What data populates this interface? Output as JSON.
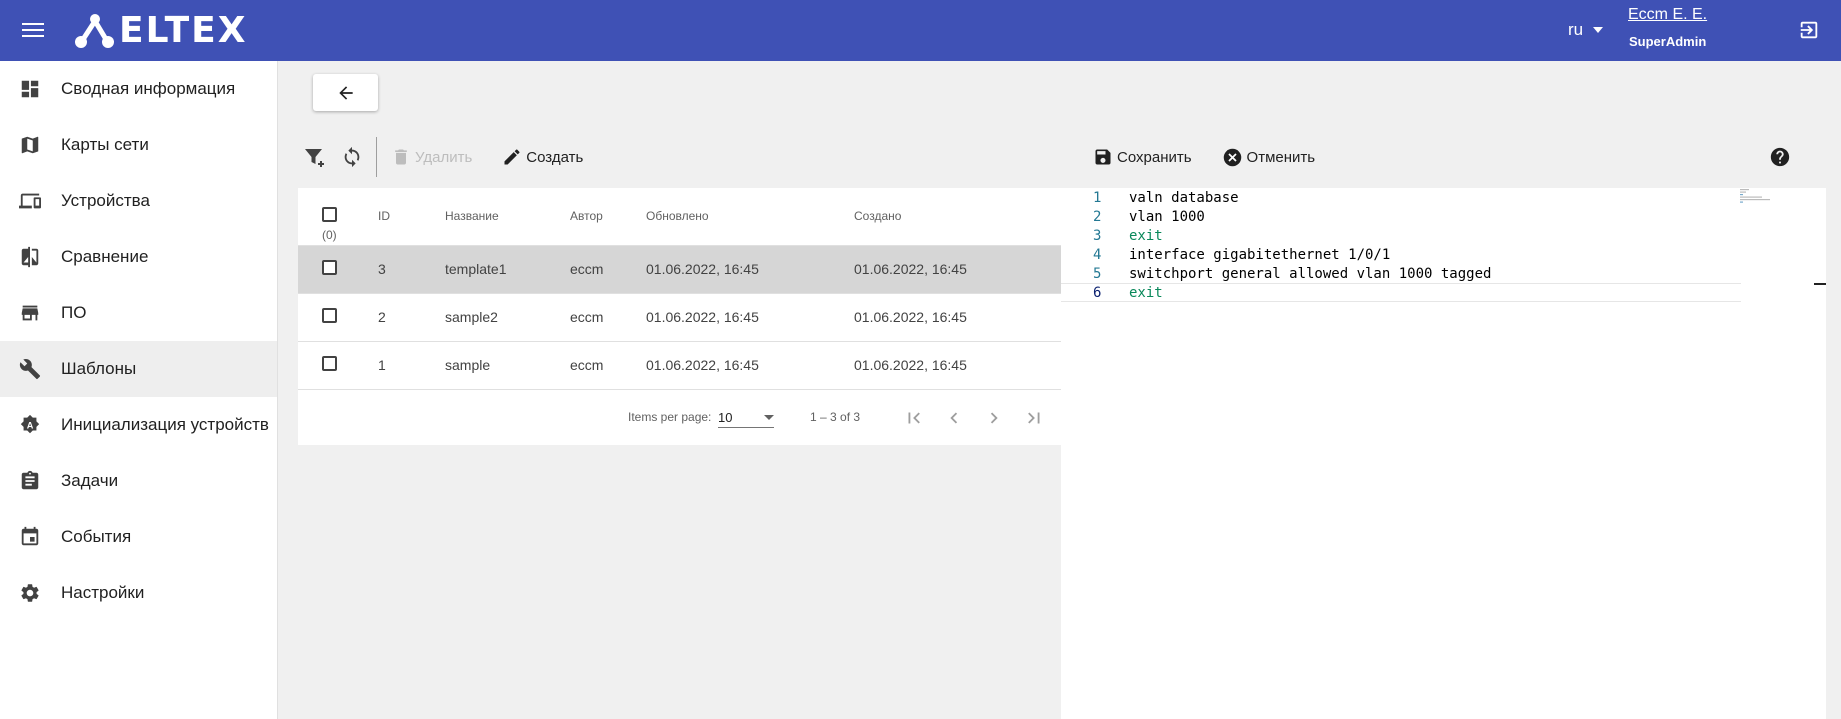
{
  "header": {
    "logo_text": "ELTEX",
    "lang": "ru",
    "user_name": "Eccm E. E.",
    "user_role": "SuperAdmin",
    "bg_color": "#3f51b5"
  },
  "sidebar": {
    "items": [
      {
        "label": "Сводная информация",
        "icon": "dashboard-icon"
      },
      {
        "label": "Карты сети",
        "icon": "map-icon"
      },
      {
        "label": "Устройства",
        "icon": "devices-icon"
      },
      {
        "label": "Сравнение",
        "icon": "compare-icon"
      },
      {
        "label": "ПО",
        "icon": "store-icon"
      },
      {
        "label": "Шаблоны",
        "icon": "wrench-icon",
        "active": true
      },
      {
        "label": "Инициализация устройств",
        "icon": "init-gear-icon"
      },
      {
        "label": "Задачи",
        "icon": "clipboard-icon"
      },
      {
        "label": "События",
        "icon": "calendar-icon"
      },
      {
        "label": "Настройки",
        "icon": "settings-gear-icon"
      }
    ]
  },
  "toolbar": {
    "delete_label": "Удалить",
    "create_label": "Создать",
    "save_label": "Сохранить",
    "cancel_label": "Отменить"
  },
  "table": {
    "columns": [
      "ID",
      "Название",
      "Автор",
      "Обновлено",
      "Создано"
    ],
    "selected_count": "(0)",
    "rows": [
      {
        "id": "3",
        "name": "template1",
        "author": "eccm",
        "updated": "01.06.2022, 16:45",
        "created": "01.06.2022, 16:45",
        "selected": true
      },
      {
        "id": "2",
        "name": "sample2",
        "author": "eccm",
        "updated": "01.06.2022, 16:45",
        "created": "01.06.2022, 16:45",
        "selected": false
      },
      {
        "id": "1",
        "name": "sample",
        "author": "eccm",
        "updated": "01.06.2022, 16:45",
        "created": "01.06.2022, 16:45",
        "selected": false
      }
    ]
  },
  "pager": {
    "items_per_page_label": "Items per page:",
    "page_size": "10",
    "range": "1 – 3 of 3"
  },
  "editor": {
    "lines": [
      {
        "n": "1",
        "text": "valn database",
        "kw": false
      },
      {
        "n": "2",
        "text": "vlan 1000",
        "kw": false
      },
      {
        "n": "3",
        "text": "exit",
        "kw": true
      },
      {
        "n": "4",
        "text": "interface gigabitethernet 1/0/1",
        "kw": false
      },
      {
        "n": "5",
        "text": "switchport general allowed vlan 1000 tagged",
        "kw": false
      },
      {
        "n": "6",
        "text": "exit",
        "kw": true,
        "current": true
      }
    ]
  }
}
